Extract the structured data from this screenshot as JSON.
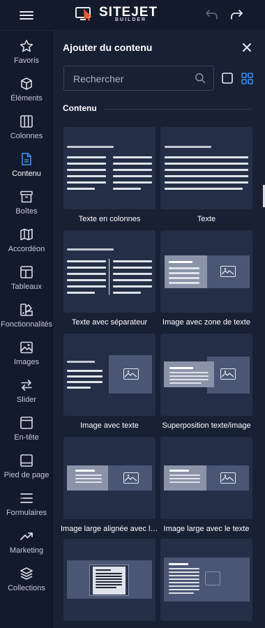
{
  "topbar": {
    "logo_text": "SITEJET",
    "logo_sub": "BUILDER"
  },
  "sidebar": {
    "items": [
      {
        "label": "Favoris",
        "icon": "star-icon"
      },
      {
        "label": "Éléments",
        "icon": "cube-icon"
      },
      {
        "label": "Colonnes",
        "icon": "columns-icon"
      },
      {
        "label": "Contenu",
        "icon": "document-icon",
        "active": true
      },
      {
        "label": "Boîtes",
        "icon": "archive-box-icon"
      },
      {
        "label": "Accordéon",
        "icon": "map-fold-icon"
      },
      {
        "label": "Tableaux",
        "icon": "table-icon"
      },
      {
        "label": "Fonctionnalités",
        "icon": "swatch-icon"
      },
      {
        "label": "Images",
        "icon": "image-icon"
      },
      {
        "label": "Slider",
        "icon": "arrows-swap-icon"
      },
      {
        "label": "En-tête",
        "icon": "header-window-icon"
      },
      {
        "label": "Pied de page",
        "icon": "footer-window-icon"
      },
      {
        "label": "Formulaires",
        "icon": "form-lines-icon"
      },
      {
        "label": "Marketing",
        "icon": "trend-up-icon"
      },
      {
        "label": "Collections",
        "icon": "layers-icon"
      }
    ]
  },
  "panel": {
    "title": "Ajouter du contenu",
    "search_placeholder": "Rechercher",
    "section_label": "Contenu",
    "cards": [
      {
        "label": "Texte en colonnes"
      },
      {
        "label": "Texte"
      },
      {
        "label": "Texte avec séparateur"
      },
      {
        "label": "Image avec zone de texte"
      },
      {
        "label": "Image avec texte"
      },
      {
        "label": "Superposition texte/image"
      },
      {
        "label": "Image large alignée avec le texte"
      },
      {
        "label": "Image large avec le texte"
      },
      {
        "label": ""
      },
      {
        "label": ""
      }
    ]
  },
  "colors": {
    "background": "#131a2b",
    "panel": "#182034",
    "card": "#242e46",
    "accent": "#3d8ef0",
    "logo_icon": "#f05a32"
  }
}
